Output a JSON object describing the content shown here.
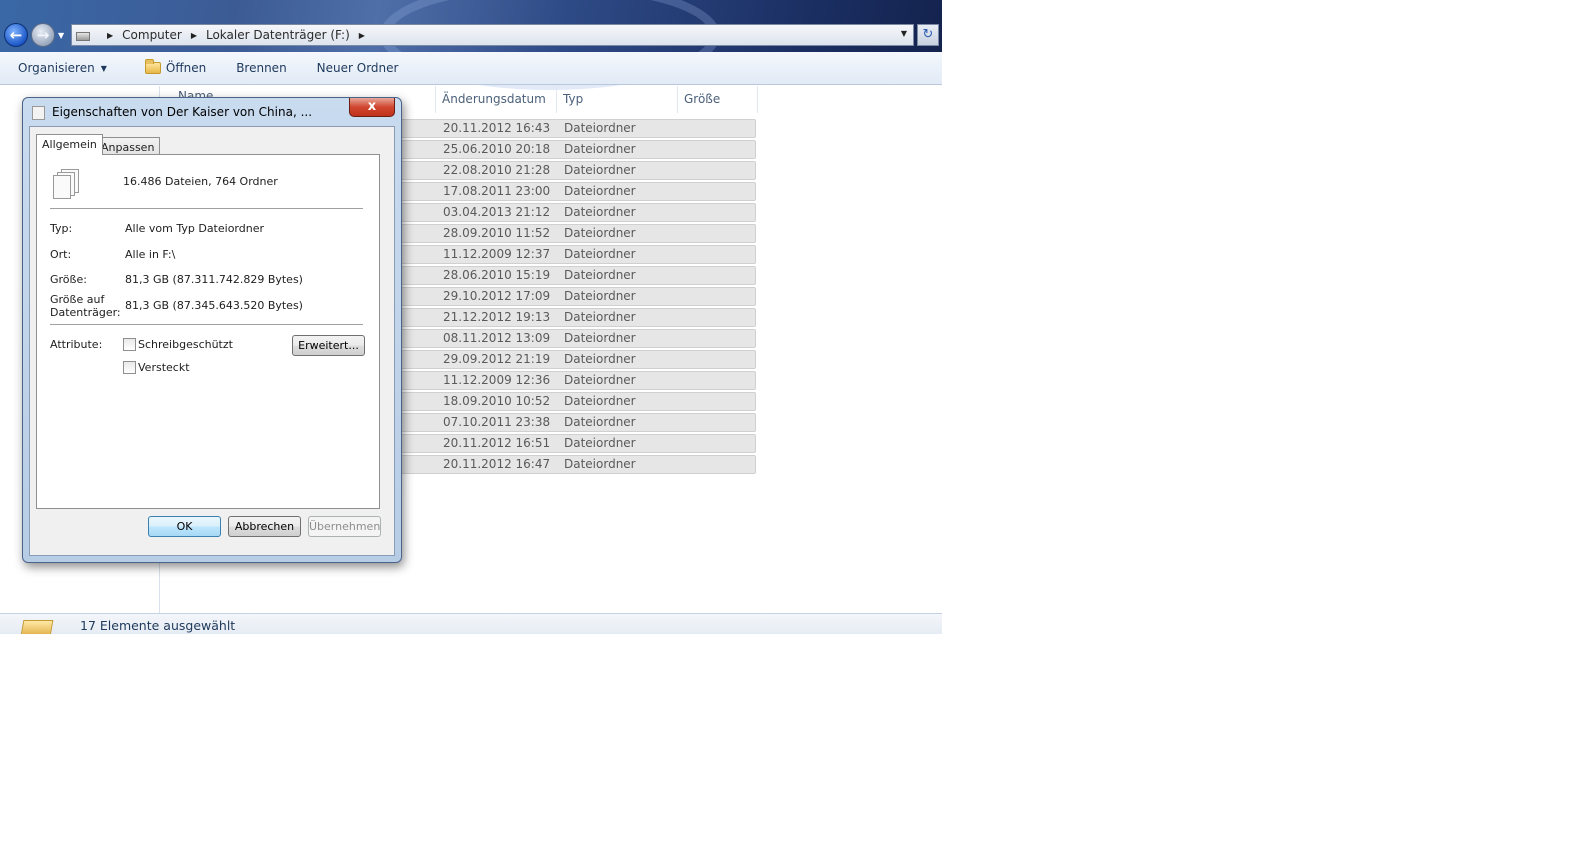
{
  "explorer": {
    "address_drive_icon": "drive-icon",
    "breadcrumb": [
      "Computer",
      "Lokaler Datenträger (F:)"
    ],
    "toolbar": {
      "organize": "Organisieren",
      "open": "Öffnen",
      "burn": "Brennen",
      "new_folder": "Neuer Ordner"
    },
    "columns": {
      "name": "Name",
      "date": "Änderungsdatum",
      "type": "Typ",
      "size": "Größe"
    },
    "rows": [
      {
        "date": "20.11.2012 16:43",
        "type": "Dateiordner"
      },
      {
        "date": "25.06.2010 20:18",
        "type": "Dateiordner"
      },
      {
        "date": "22.08.2010 21:28",
        "type": "Dateiordner"
      },
      {
        "date": "17.08.2011 23:00",
        "type": "Dateiordner"
      },
      {
        "date": "03.04.2013 21:12",
        "type": "Dateiordner"
      },
      {
        "date": "28.09.2010 11:52",
        "type": "Dateiordner"
      },
      {
        "date": "11.12.2009 12:37",
        "type": "Dateiordner"
      },
      {
        "date": "28.06.2010 15:19",
        "type": "Dateiordner"
      },
      {
        "date": "29.10.2012 17:09",
        "type": "Dateiordner"
      },
      {
        "date": "21.12.2012 19:13",
        "type": "Dateiordner"
      },
      {
        "date": "08.11.2012 13:09",
        "type": "Dateiordner"
      },
      {
        "date": "29.09.2012 21:19",
        "type": "Dateiordner"
      },
      {
        "date": "11.12.2009 12:36",
        "type": "Dateiordner"
      },
      {
        "date": "18.09.2010 10:52",
        "type": "Dateiordner"
      },
      {
        "date": "07.10.2011 23:38",
        "type": "Dateiordner"
      },
      {
        "date": "20.11.2012 16:51",
        "type": "Dateiordner"
      },
      {
        "date": "20.11.2012 16:47",
        "type": "Dateiordner"
      }
    ],
    "status": "17 Elemente ausgewählt"
  },
  "dialog": {
    "title": "Eigenschaften von Der Kaiser von China, ...",
    "close": "x",
    "tabs": {
      "general": "Allgemein",
      "customize": "Anpassen"
    },
    "summary": "16.486 Dateien, 764 Ordner",
    "fields": {
      "type_label": "Typ:",
      "type_value": "Alle vom Typ Dateiordner",
      "location_label": "Ort:",
      "location_value": "Alle in F:\\",
      "size_label": "Größe:",
      "size_value": "81,3 GB (87.311.742.829 Bytes)",
      "disk_size_label": "Größe auf Datenträger:",
      "disk_size_value": "81,3 GB (87.345.643.520 Bytes)",
      "attributes_label": "Attribute:",
      "readonly_label": "Schreibgeschützt",
      "readonly_checked": false,
      "hidden_label": "Versteckt",
      "hidden_checked": false
    },
    "buttons": {
      "advanced": "Erweitert...",
      "ok": "OK",
      "cancel": "Abbrechen",
      "apply": "Übernehmen"
    }
  },
  "colors": {
    "titlebar": "#2e4a86",
    "toolbar_text": "#1e395b",
    "ok_border": "#3c7fb1",
    "close_red": "#c0311b"
  }
}
